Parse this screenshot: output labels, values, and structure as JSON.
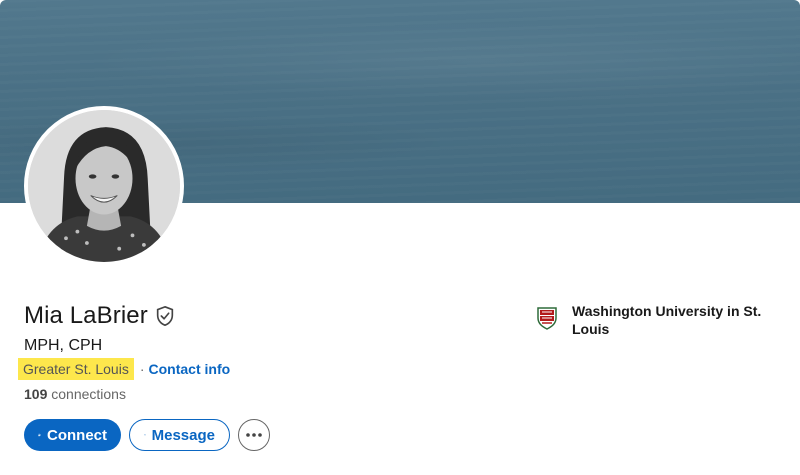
{
  "profile": {
    "name": "Mia LaBrier",
    "headline": "MPH, CPH",
    "location": "Greater St. Louis",
    "separator": "·",
    "contact_info": "Contact info",
    "connections_count": "109",
    "connections_label": " connections",
    "avatar_icon": "profile-photo"
  },
  "actions": {
    "connect_label": "Connect",
    "message_label": "Message",
    "more_icon": "ellipsis-icon"
  },
  "education": {
    "name": "Washington University in St. Louis",
    "logo_icon": "university-shield-icon"
  },
  "colors": {
    "accent": "#0a66c2",
    "banner": "#4a7085",
    "highlight": "#fde74c"
  }
}
